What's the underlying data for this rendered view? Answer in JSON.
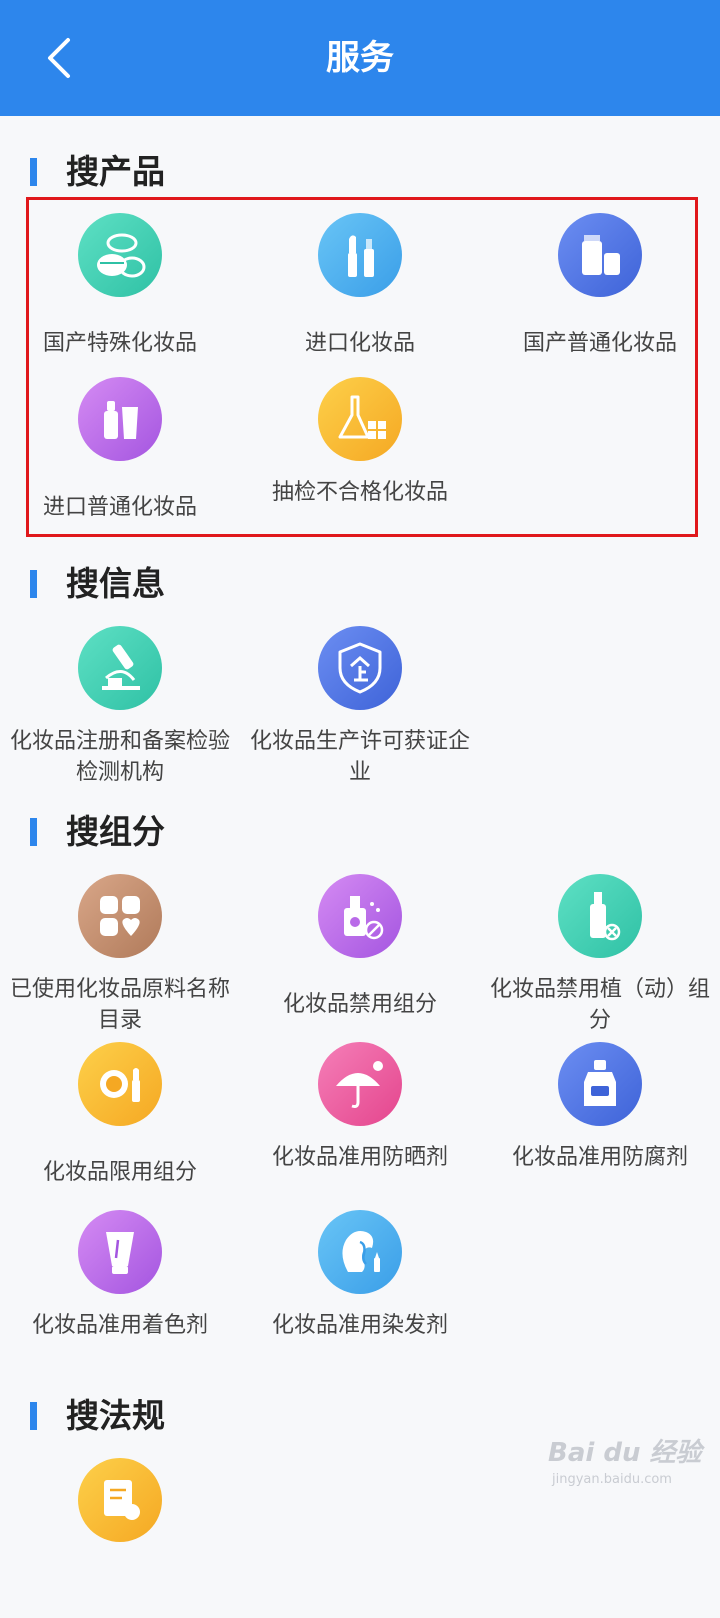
{
  "header": {
    "title": "服务",
    "back_icon": "chevron-left-icon",
    "color": "#2d86ec"
  },
  "highlight_color": "#e0181b",
  "sections": [
    {
      "title": "搜产品",
      "items": [
        {
          "label": "国产特殊化妆品",
          "icon": "compact-powder-icon",
          "color": "#3ccdb1"
        },
        {
          "label": "进口化妆品",
          "icon": "lipstick-icon",
          "color": "#4fb2f0"
        },
        {
          "label": "国产普通化妆品",
          "icon": "cream-tubes-icon",
          "color": "#4a72e0"
        },
        {
          "label": "进口普通化妆品",
          "icon": "bottle-tube-icon",
          "color": "#b96ae8"
        },
        {
          "label": "抽检不合格化妆品",
          "icon": "flask-icon",
          "color": "#f7b731"
        }
      ]
    },
    {
      "title": "搜信息",
      "items": [
        {
          "label": "化妆品注册和备案检验检测机构",
          "icon": "microscope-icon",
          "color": "#3ccdb1"
        },
        {
          "label": "化妆品生产许可获证企业",
          "icon": "enterprise-shield-icon",
          "color": "#4a72e0"
        }
      ]
    },
    {
      "title": "搜组分",
      "items": [
        {
          "label": "已使用化妆品原料名称目录",
          "icon": "grid-blocks-icon",
          "color": "#c28d6e"
        },
        {
          "label": "化妆品禁用组分",
          "icon": "banned-bottle-icon",
          "color": "#b96ae8"
        },
        {
          "label": "化妆品禁用植（动）组分",
          "icon": "banned-vial-icon",
          "color": "#3ccdb1"
        },
        {
          "label": "化妆品限用组分",
          "icon": "mirror-lipstick-icon",
          "color": "#f7b731"
        },
        {
          "label": "化妆品准用防晒剂",
          "icon": "umbrella-sun-icon",
          "color": "#ec5b9f"
        },
        {
          "label": "化妆品准用防腐剂",
          "icon": "preservative-bottle-icon",
          "color": "#4a72e0"
        },
        {
          "label": "化妆品准用着色剂",
          "icon": "color-tube-icon",
          "color": "#b96ae8"
        },
        {
          "label": "化妆品准用染发剂",
          "icon": "hair-dye-icon",
          "color": "#4fb2f0"
        }
      ]
    },
    {
      "title": "搜法规",
      "items": [
        {
          "label": "",
          "icon": "regulation-document-icon",
          "color": "#f7b731"
        }
      ]
    }
  ],
  "watermark": {
    "line1": "Bai du 经验",
    "line2": "jingyan.baidu.com"
  }
}
